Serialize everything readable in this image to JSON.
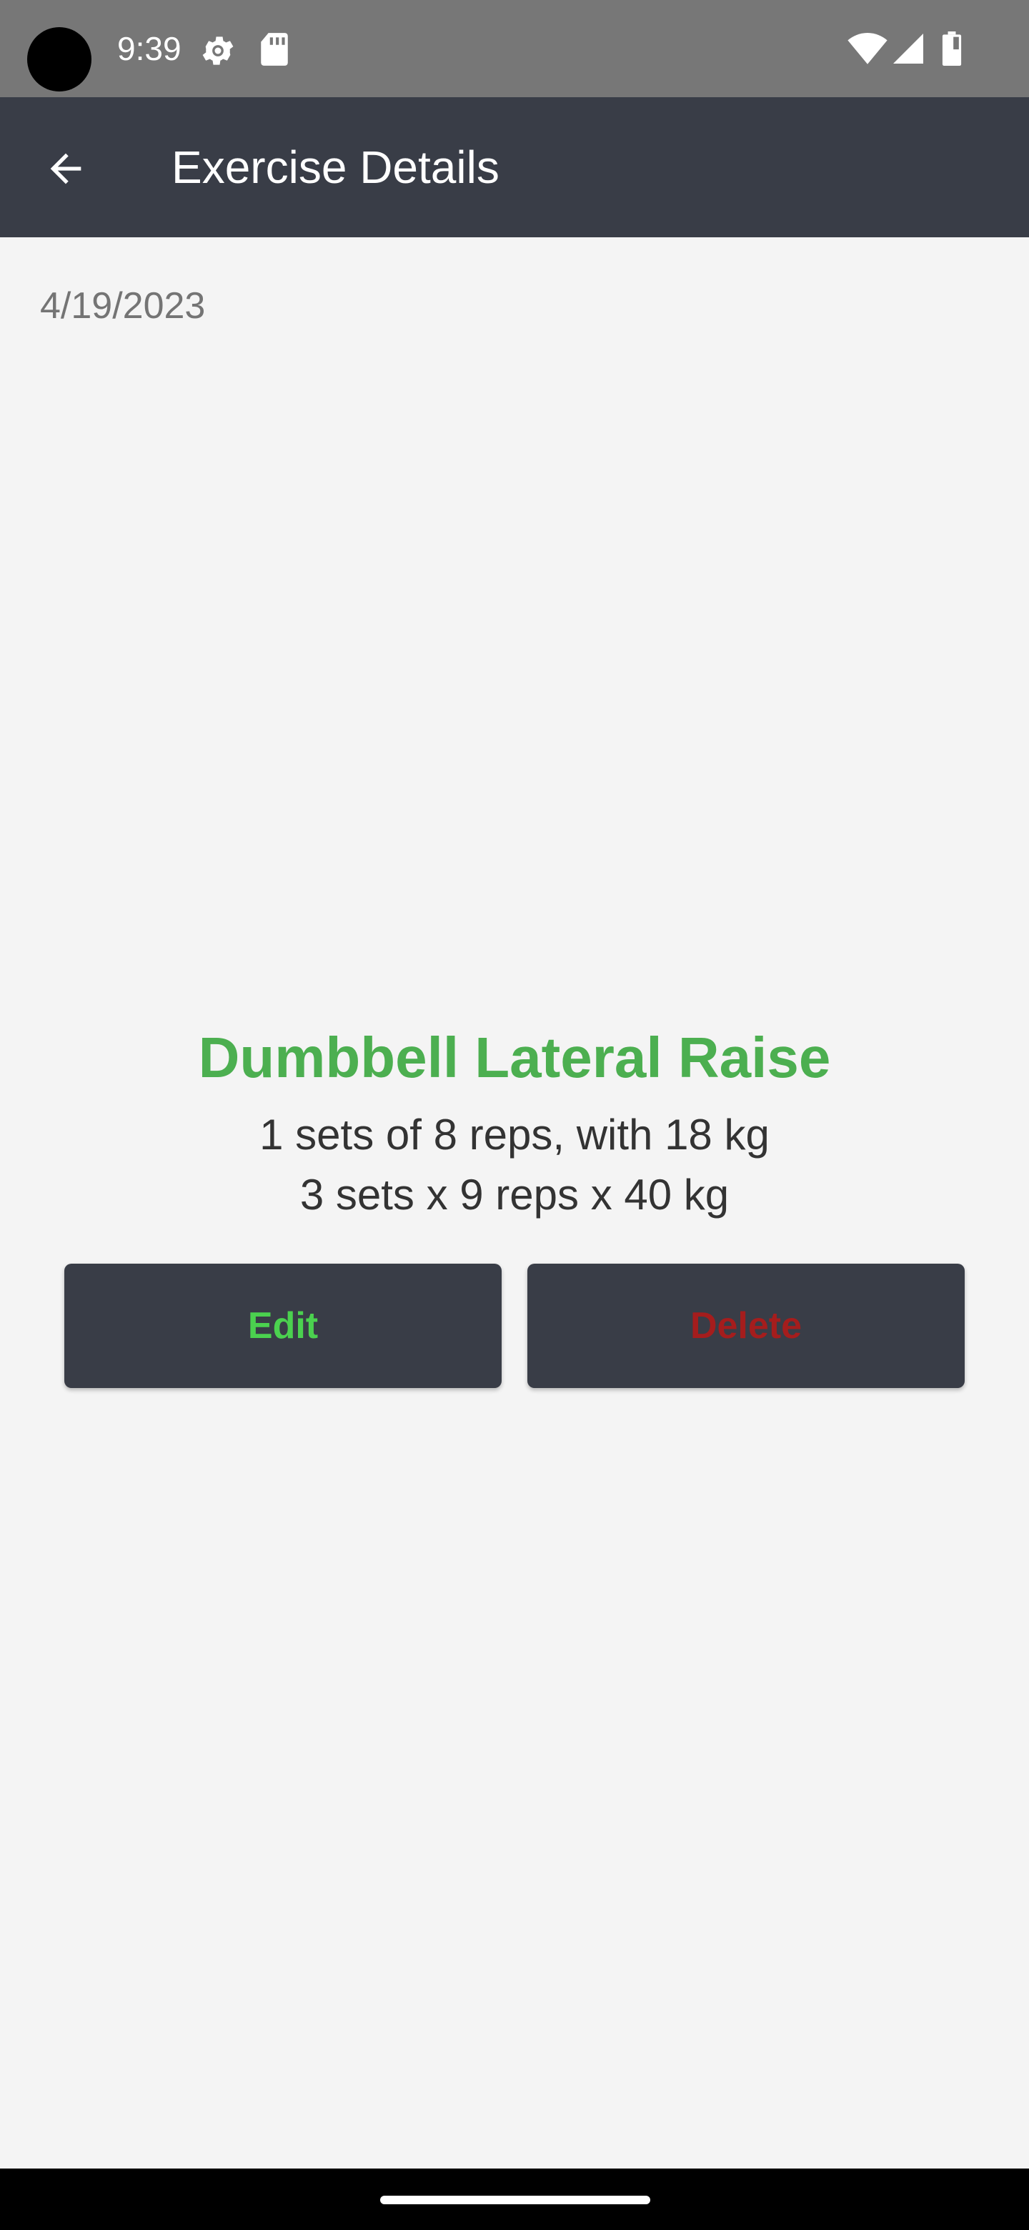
{
  "status_bar": {
    "time": "9:39",
    "icons": [
      "camera-hole",
      "gear-icon",
      "sd-card-icon",
      "wifi-icon",
      "signal-icon",
      "battery-icon"
    ]
  },
  "app_bar": {
    "title": "Exercise Details",
    "back_icon": "arrow-back-icon",
    "background": "#393d47"
  },
  "entry": {
    "date": "4/19/2023",
    "exercise_name": "Dumbbell Lateral Raise",
    "summary": "1 sets of 8 reps, with 18 kg",
    "sets": "3 sets x 9 reps x 40 kg"
  },
  "actions": {
    "edit_label": "Edit",
    "delete_label": "Delete"
  },
  "colors": {
    "accent_green": "#4caf50",
    "edit_green": "#4bd14f",
    "delete_red": "#a51d1d",
    "background": "#f4f4f4"
  }
}
